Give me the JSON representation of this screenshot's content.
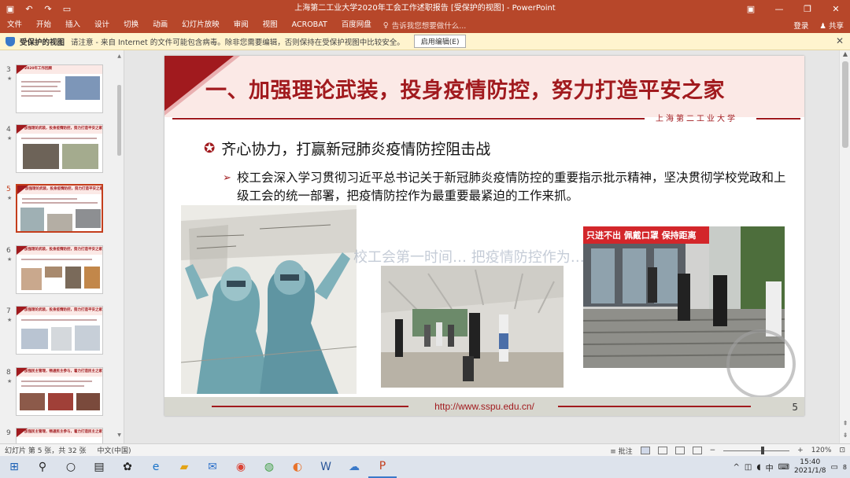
{
  "window": {
    "title": "上海第二工业大学2020年工会工作述职报告 [受保护的视图] - PowerPoint",
    "controls": [
      "ribbon-display",
      "minimize",
      "restore",
      "close"
    ]
  },
  "quick_access": {
    "save": "save-icon",
    "undo": "undo-icon",
    "redo": "redo-icon",
    "start": "present-icon"
  },
  "ribbon_tabs": [
    "文件",
    "开始",
    "插入",
    "设计",
    "切换",
    "动画",
    "幻灯片放映",
    "审阅",
    "视图",
    "ACROBAT",
    "百度网盘"
  ],
  "tell_me": {
    "placeholder": "告诉我您想要做什么..."
  },
  "account": {
    "login": "登录",
    "share": "共享"
  },
  "protected_view": {
    "title": "受保护的视图",
    "message": "请注意 - 来自 Internet 的文件可能包含病毒。除非您需要编辑，否则保持在受保护视图中比较安全。",
    "button": "启用编辑(E)"
  },
  "thumbnails": [
    {
      "num": "3",
      "title": "2020年工作回顾"
    },
    {
      "num": "4",
      "title": "加强理论武装，投身疫情防控，努力打造平安之家"
    },
    {
      "num": "5",
      "title": "加强理论武装，投身疫情防控，努力打造平安之家",
      "selected": true
    },
    {
      "num": "6",
      "title": "加强理论武装，投身疫情防控，努力打造平安之家"
    },
    {
      "num": "7",
      "title": "加强理论武装，投身疫情防控，努力打造平安之家"
    },
    {
      "num": "8",
      "title": "加强民主管理，畅通民主参与，着力打造民主之家"
    },
    {
      "num": "9",
      "title": "加强民主管理，畅通民主参与，着力打造民主之家"
    }
  ],
  "slide": {
    "title": "一、加强理论武装，投身疫情防控，努力打造平安之家",
    "school": "上海第二工业大学",
    "subtitle": "齐心协力，打赢新冠肺炎疫情防控阻击战",
    "bullet": "校工会深入学习贯彻习近平总书记关于新冠肺炎疫情防控的重要指示批示精神，坚决贯彻学校党政和上级工会的统一部署，把疫情防控作为最重要最紧迫的工作来抓。",
    "banner_text": "只进不出  佩戴口罩  保持距离",
    "watermark": "校工会第一时间…  把疫情防控作为…",
    "footer_url": "http://www.sspu.edu.cn/",
    "page_number": "5"
  },
  "status": {
    "slide_info": "幻灯片 第 5 张，共 32 张",
    "language": "中文(中国)",
    "notes": "批注",
    "zoom": "120%",
    "zoom_fraction": 0.6
  },
  "taskbar": {
    "time": "15:40",
    "date": "2021/1/8",
    "ime": "中",
    "notifications": "8"
  }
}
